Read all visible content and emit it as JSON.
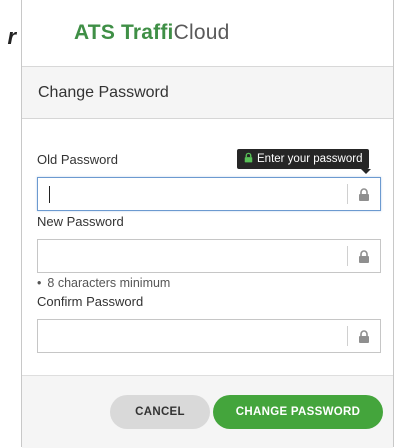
{
  "brand": {
    "part1": "ATS",
    "part2": "Traffi",
    "part3": "Cloud"
  },
  "edge_glyph": "r",
  "modal": {
    "title": "Change Password"
  },
  "fields": {
    "old": {
      "label": "Old Password",
      "value": "",
      "placeholder": ""
    },
    "new": {
      "label": "New Password",
      "value": "",
      "placeholder": ""
    },
    "confirm": {
      "label": "Confirm Password",
      "value": "",
      "placeholder": ""
    }
  },
  "tooltip": {
    "text": "Enter your password"
  },
  "hint": {
    "bullet": "•",
    "text": "8 characters minimum"
  },
  "buttons": {
    "cancel": "CANCEL",
    "submit": "CHANGE PASSWORD"
  },
  "colors": {
    "brand_green": "#3f8f46",
    "primary_button": "#44a53c",
    "cancel_button": "#d9d9d9",
    "tooltip_bg": "#262626"
  },
  "icons": {
    "field_addon": "lock-icon",
    "tooltip": "lock-icon"
  }
}
